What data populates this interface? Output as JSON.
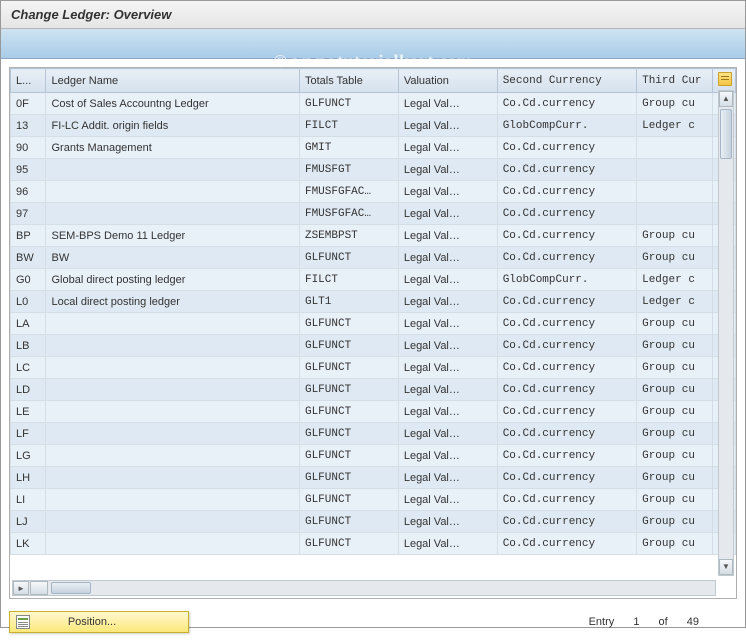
{
  "header": {
    "title": "Change Ledger: Overview"
  },
  "watermark": "© www.tutorialkart.com",
  "columns": {
    "code": "L...",
    "name": "Ledger Name",
    "totals": "Totals Table",
    "valuation": "Valuation",
    "second": "Second Currency",
    "third": "Third Cur"
  },
  "rows": [
    {
      "code": "0F",
      "name": "Cost of Sales Accountng Ledger",
      "totals": "GLFUNCT",
      "valuation": "Legal Val…",
      "second": "Co.Cd.currency",
      "third": "Group cu"
    },
    {
      "code": "13",
      "name": "FI-LC Addit. origin fields",
      "totals": "FILCT",
      "valuation": "Legal Val…",
      "second": "GlobCompCurr.",
      "third": "Ledger c"
    },
    {
      "code": "90",
      "name": "Grants Management",
      "totals": "GMIT",
      "valuation": "Legal Val…",
      "second": "Co.Cd.currency",
      "third": ""
    },
    {
      "code": "95",
      "name": "",
      "totals": "FMUSFGT",
      "valuation": "Legal Val…",
      "second": "Co.Cd.currency",
      "third": ""
    },
    {
      "code": "96",
      "name": "",
      "totals": "FMUSFGFAC…",
      "valuation": "Legal Val…",
      "second": "Co.Cd.currency",
      "third": ""
    },
    {
      "code": "97",
      "name": "",
      "totals": "FMUSFGFAC…",
      "valuation": "Legal Val…",
      "second": "Co.Cd.currency",
      "third": ""
    },
    {
      "code": "BP",
      "name": "SEM-BPS Demo 11 Ledger",
      "totals": "ZSEMBPST",
      "valuation": "Legal Val…",
      "second": "Co.Cd.currency",
      "third": "Group cu"
    },
    {
      "code": "BW",
      "name": "BW",
      "totals": "GLFUNCT",
      "valuation": "Legal Val…",
      "second": "Co.Cd.currency",
      "third": "Group cu"
    },
    {
      "code": "G0",
      "name": "Global direct posting ledger",
      "totals": "FILCT",
      "valuation": "Legal Val…",
      "second": "GlobCompCurr.",
      "third": "Ledger c"
    },
    {
      "code": "L0",
      "name": "Local direct posting ledger",
      "totals": "GLT1",
      "valuation": "Legal Val…",
      "second": "Co.Cd.currency",
      "third": "Ledger c"
    },
    {
      "code": "LA",
      "name": "",
      "totals": "GLFUNCT",
      "valuation": "Legal Val…",
      "second": "Co.Cd.currency",
      "third": "Group cu"
    },
    {
      "code": "LB",
      "name": "",
      "totals": "GLFUNCT",
      "valuation": "Legal Val…",
      "second": "Co.Cd.currency",
      "third": "Group cu"
    },
    {
      "code": "LC",
      "name": "",
      "totals": "GLFUNCT",
      "valuation": "Legal Val…",
      "second": "Co.Cd.currency",
      "third": "Group cu"
    },
    {
      "code": "LD",
      "name": "",
      "totals": "GLFUNCT",
      "valuation": "Legal Val…",
      "second": "Co.Cd.currency",
      "third": "Group cu"
    },
    {
      "code": "LE",
      "name": "",
      "totals": "GLFUNCT",
      "valuation": "Legal Val…",
      "second": "Co.Cd.currency",
      "third": "Group cu"
    },
    {
      "code": "LF",
      "name": "",
      "totals": "GLFUNCT",
      "valuation": "Legal Val…",
      "second": "Co.Cd.currency",
      "third": "Group cu"
    },
    {
      "code": "LG",
      "name": "",
      "totals": "GLFUNCT",
      "valuation": "Legal Val…",
      "second": "Co.Cd.currency",
      "third": "Group cu"
    },
    {
      "code": "LH",
      "name": "",
      "totals": "GLFUNCT",
      "valuation": "Legal Val…",
      "second": "Co.Cd.currency",
      "third": "Group cu"
    },
    {
      "code": "LI",
      "name": "",
      "totals": "GLFUNCT",
      "valuation": "Legal Val…",
      "second": "Co.Cd.currency",
      "third": "Group cu"
    },
    {
      "code": "LJ",
      "name": "",
      "totals": "GLFUNCT",
      "valuation": "Legal Val…",
      "second": "Co.Cd.currency",
      "third": "Group cu"
    },
    {
      "code": "LK",
      "name": "",
      "totals": "GLFUNCT",
      "valuation": "Legal Val…",
      "second": "Co.Cd.currency",
      "third": "Group cu"
    }
  ],
  "footer": {
    "position_label": "Position...",
    "entry_label": "Entry",
    "entry_current": "1",
    "entry_of": "of",
    "entry_total": "49"
  }
}
